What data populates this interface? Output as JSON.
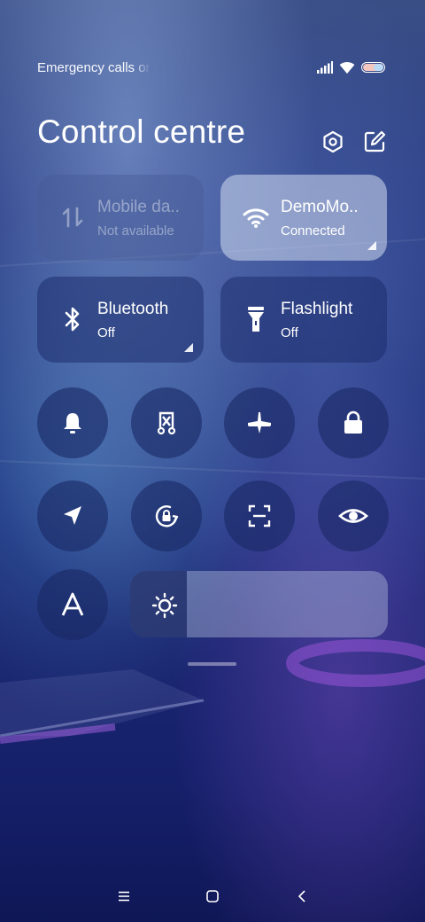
{
  "status_bar": {
    "text": "Emergency calls only",
    "icons": [
      "signal-icon",
      "wifi-icon",
      "battery-icon"
    ]
  },
  "header": {
    "title": "Control centre",
    "icons": [
      "settings-icon",
      "edit-icon"
    ]
  },
  "tiles": {
    "mobile_data": {
      "title": "Mobile da..",
      "subtitle": "Not available",
      "state": "disabled"
    },
    "wifi": {
      "title": "DemoMo..",
      "subtitle": "Connected",
      "state": "on"
    },
    "bluetooth": {
      "title": "Bluetooth",
      "subtitle": "Off",
      "state": "off"
    },
    "flashlight": {
      "title": "Flashlight",
      "subtitle": "Off",
      "state": "off"
    }
  },
  "toggles": [
    "bell-icon",
    "screenshot-icon",
    "airplane-icon",
    "lock-icon",
    "location-icon",
    "rotation-lock-icon",
    "scanner-icon",
    "eye-icon",
    "font-icon"
  ],
  "font_button": {
    "label": "A"
  },
  "brightness": {
    "level": 0.22,
    "icon": "sun-icon"
  },
  "navigation": [
    "menu-icon",
    "home-icon",
    "back-icon"
  ],
  "colors": {
    "accent_on": "#d2dcf0",
    "tile_off": "#1e2d6e"
  }
}
